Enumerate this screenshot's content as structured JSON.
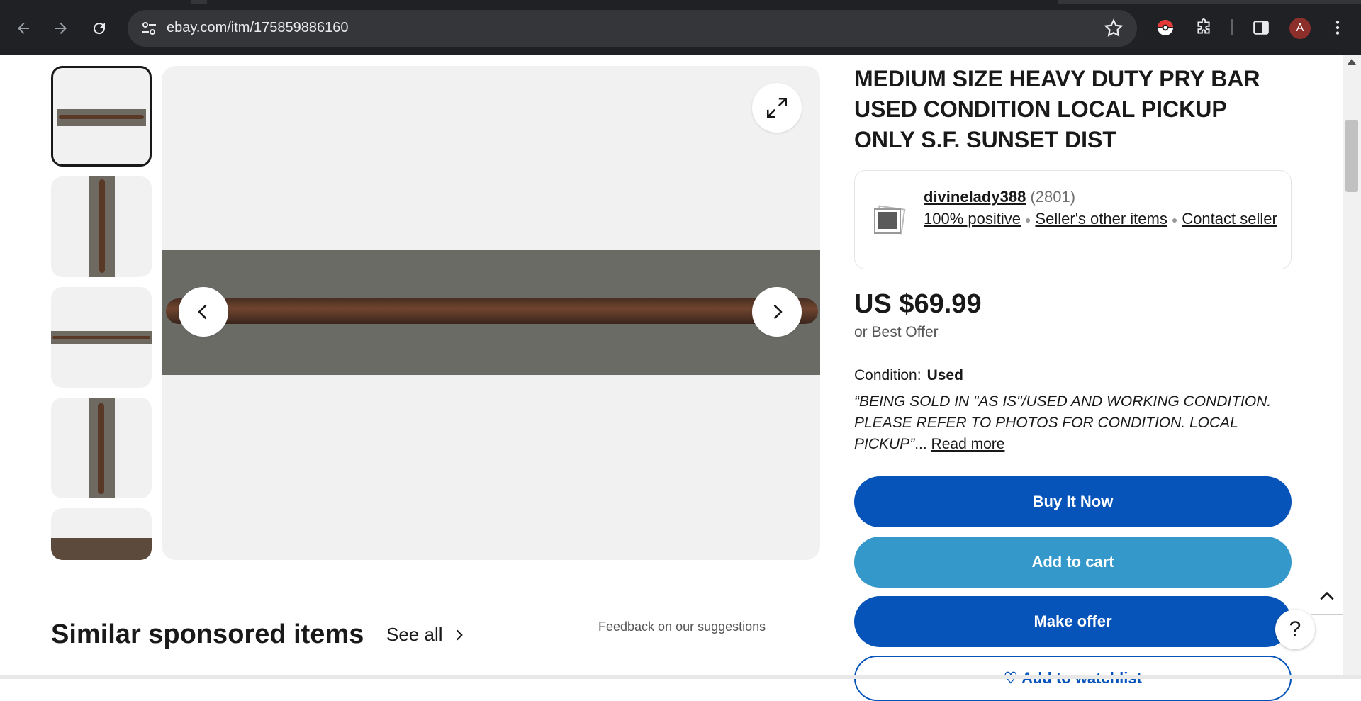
{
  "browser": {
    "url": "ebay.com/itm/175859886160",
    "profile_initial": "A",
    "icons": [
      "back-icon",
      "forward-icon",
      "reload-icon",
      "site-settings-icon",
      "bookmark-star-icon",
      "pokeball-extension-icon",
      "extensions-puzzle-icon",
      "side-panel-icon",
      "kebab-menu-icon"
    ]
  },
  "listing": {
    "title": "MEDIUM SIZE HEAVY DUTY PRY BAR USED CONDITION LOCAL PICKUP ONLY S.F. SUNSET DIST",
    "seller": {
      "name": "divinelady388",
      "feedback_count": "(2801)",
      "positive": "100% positive",
      "other_items": "Seller's other items",
      "contact": "Contact seller"
    },
    "price": "US $69.99",
    "best_offer": "or Best Offer",
    "condition_label": "Condition:",
    "condition_value": "Used",
    "description_quote_open": "“",
    "description": "BEING SOLD IN \"AS IS\"/USED AND WORKING CONDITION. PLEASE REFER TO PHOTOS FOR CONDITION. LOCAL PICKUP",
    "description_quote_close": "”",
    "ellipsis": "...",
    "read_more": "Read more",
    "buttons": {
      "buy": "Buy It Now",
      "cart": "Add to cart",
      "offer": "Make offer",
      "watch": "♡ Add to watchlist"
    }
  },
  "gallery": {
    "thumbnail_count": 5,
    "selected_index": 0
  },
  "similar": {
    "heading": "Similar sponsored items",
    "see_all": "See all",
    "feedback": "Feedback on our suggestions"
  },
  "help_label": "?"
}
